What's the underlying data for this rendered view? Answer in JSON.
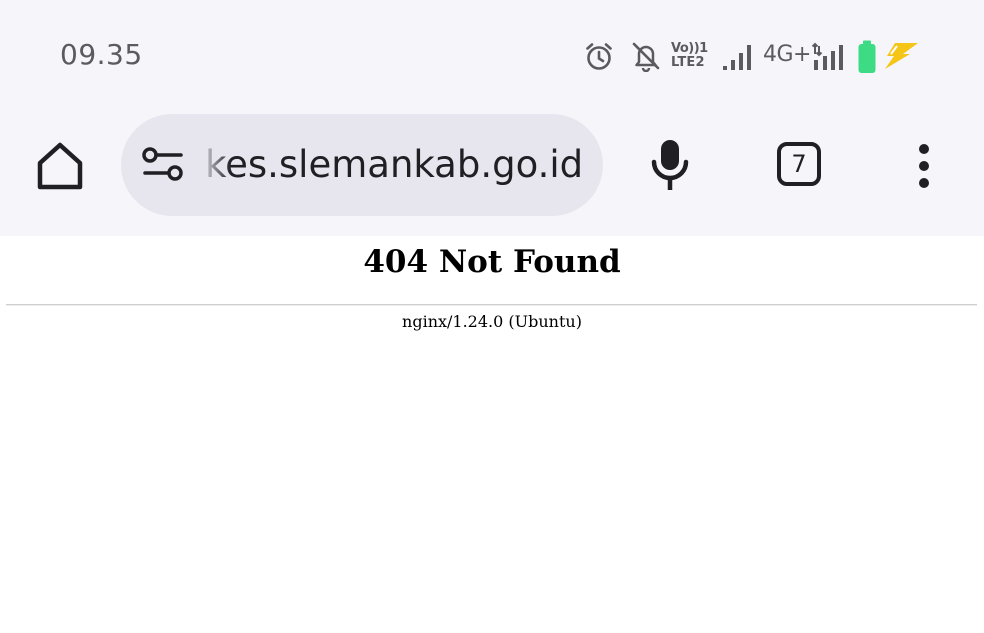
{
  "status_bar": {
    "time": "09.35",
    "volte_line1": "Vo))1",
    "volte_line2": "LTE2",
    "network_type": "4G+",
    "icons": [
      "alarm-icon",
      "bell-off-icon",
      "volte-icon",
      "signal-icon",
      "network-type-icon",
      "signal-icon",
      "battery-icon",
      "charging-icon"
    ],
    "battery_color": "#3ddc84",
    "charging_color": "#f5c518"
  },
  "toolbar": {
    "url": "kes.slemankab.go.id",
    "tab_count": "7",
    "icons": [
      "home-icon",
      "site-settings-icon",
      "mic-icon",
      "tab-switcher-icon",
      "more-vert-icon"
    ]
  },
  "page": {
    "heading": "404 Not Found",
    "server": "nginx/1.24.0 (Ubuntu)"
  }
}
